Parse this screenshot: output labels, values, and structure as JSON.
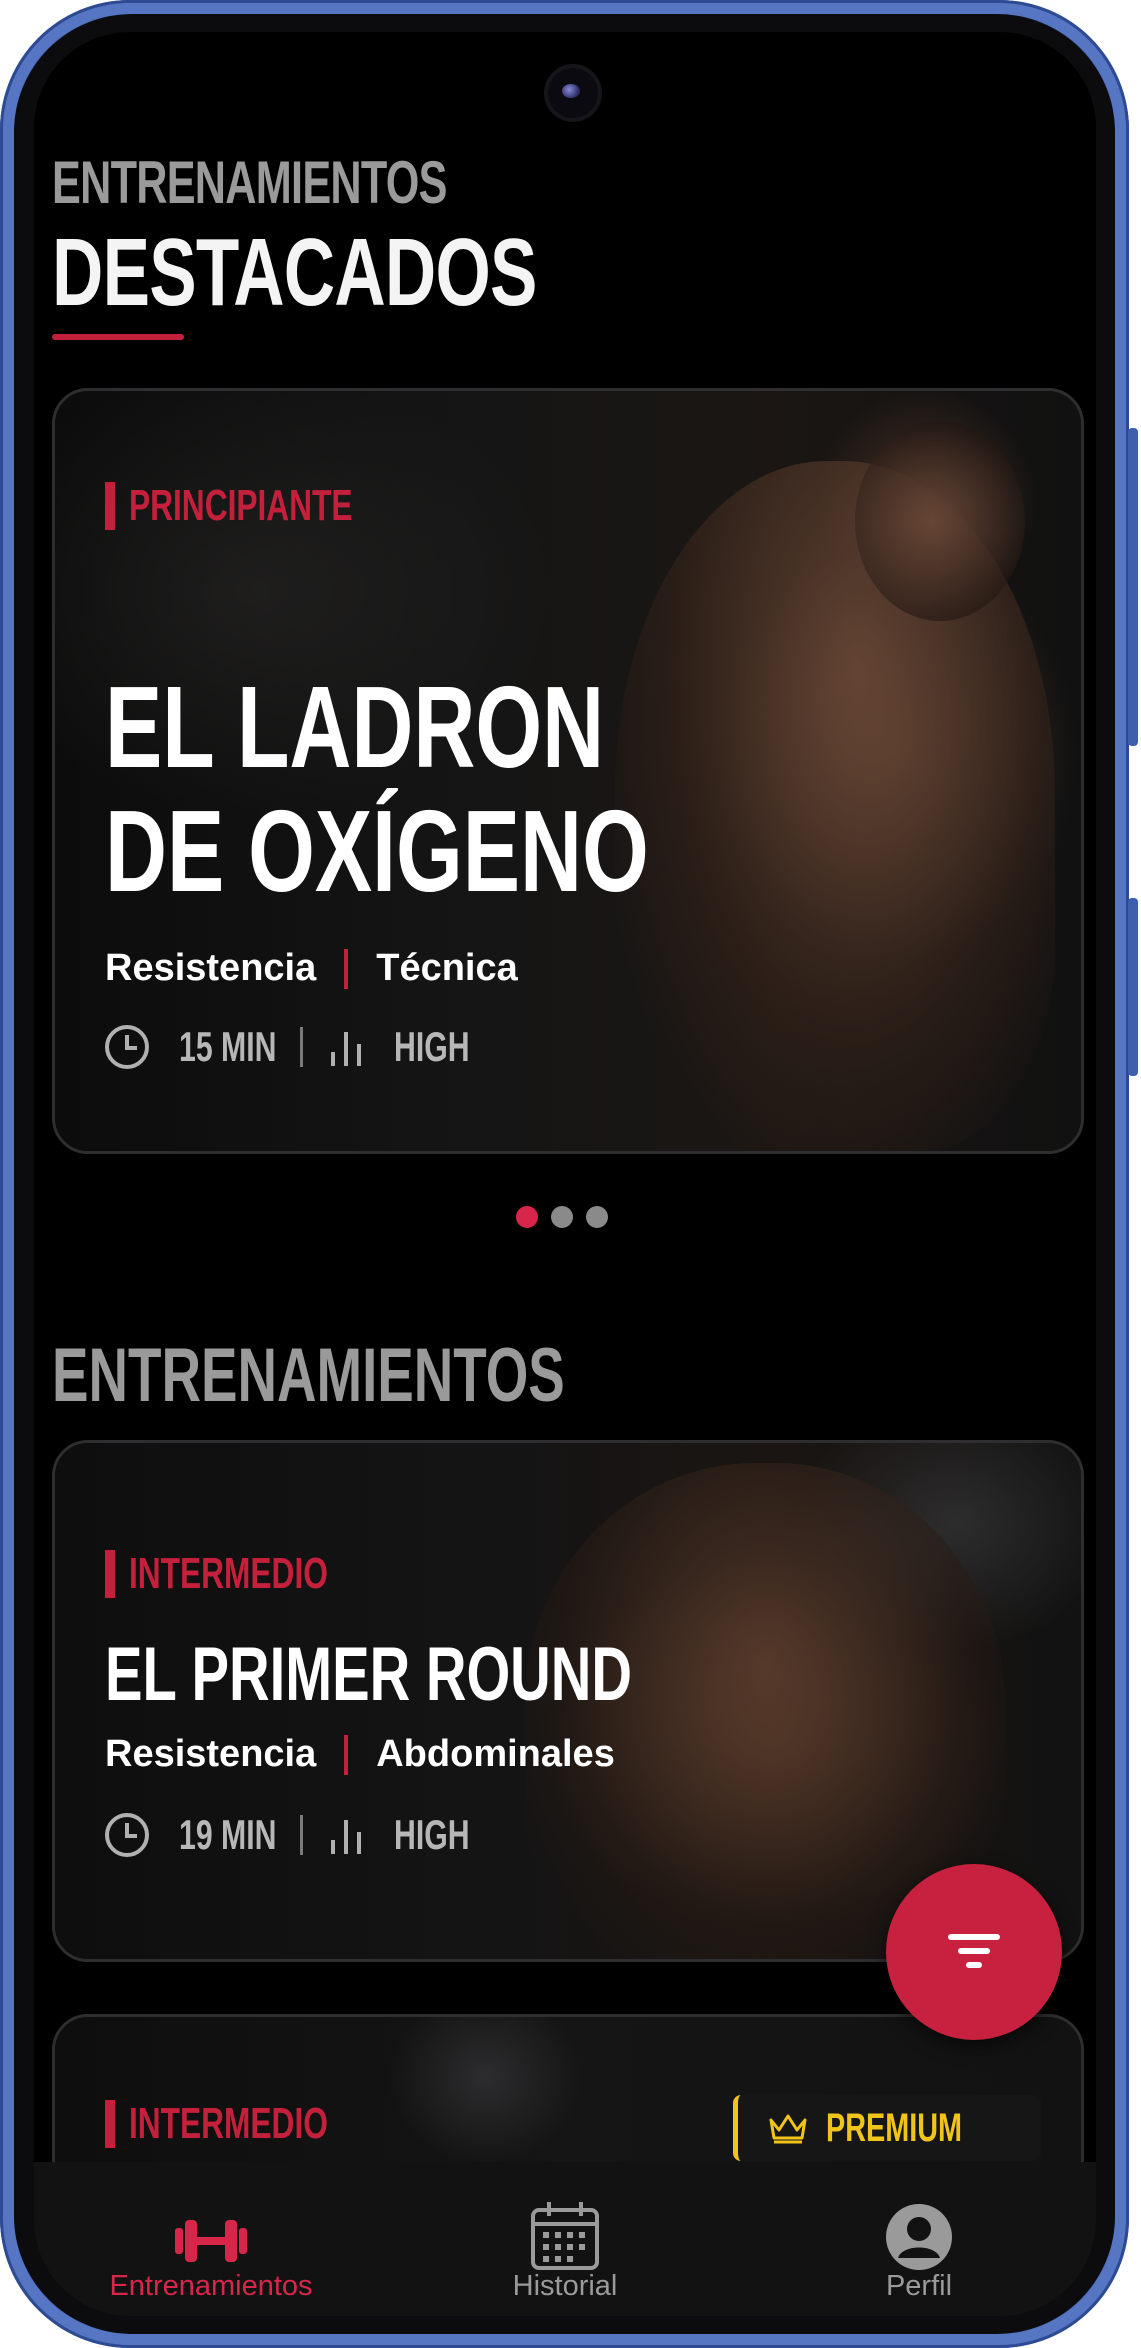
{
  "header": {
    "eyebrow": "ENTRENAMIENTOS",
    "title": "DESTACADOS"
  },
  "featured": {
    "level": "PRINCIPIANTE",
    "title_line1": "EL LADRON",
    "title_line2": "DE OXÍGENO",
    "tag1": "Resistencia",
    "tag2": "Técnica",
    "duration": "15 MIN",
    "intensity": "HIGH",
    "carousel_index": 1,
    "carousel_count": 3
  },
  "section_title": "ENTRENAMIENTOS",
  "workouts": [
    {
      "level": "INTERMEDIO",
      "title": "EL PRIMER ROUND",
      "tag1": "Resistencia",
      "tag2": "Abdominales",
      "duration": "19 MIN",
      "intensity": "HIGH"
    },
    {
      "level": "INTERMEDIO",
      "badge": "PREMIUM"
    }
  ],
  "fab": {
    "icon": "filter-icon"
  },
  "nav": {
    "items": [
      {
        "label": "Entrenamientos",
        "icon": "dumbbell-icon",
        "active": true
      },
      {
        "label": "Historial",
        "icon": "calendar-icon",
        "active": false
      },
      {
        "label": "Perfil",
        "icon": "user-icon",
        "active": false
      }
    ]
  },
  "colors": {
    "accent": "#C8213F",
    "premium": "#F0C419",
    "background": "#000000"
  }
}
